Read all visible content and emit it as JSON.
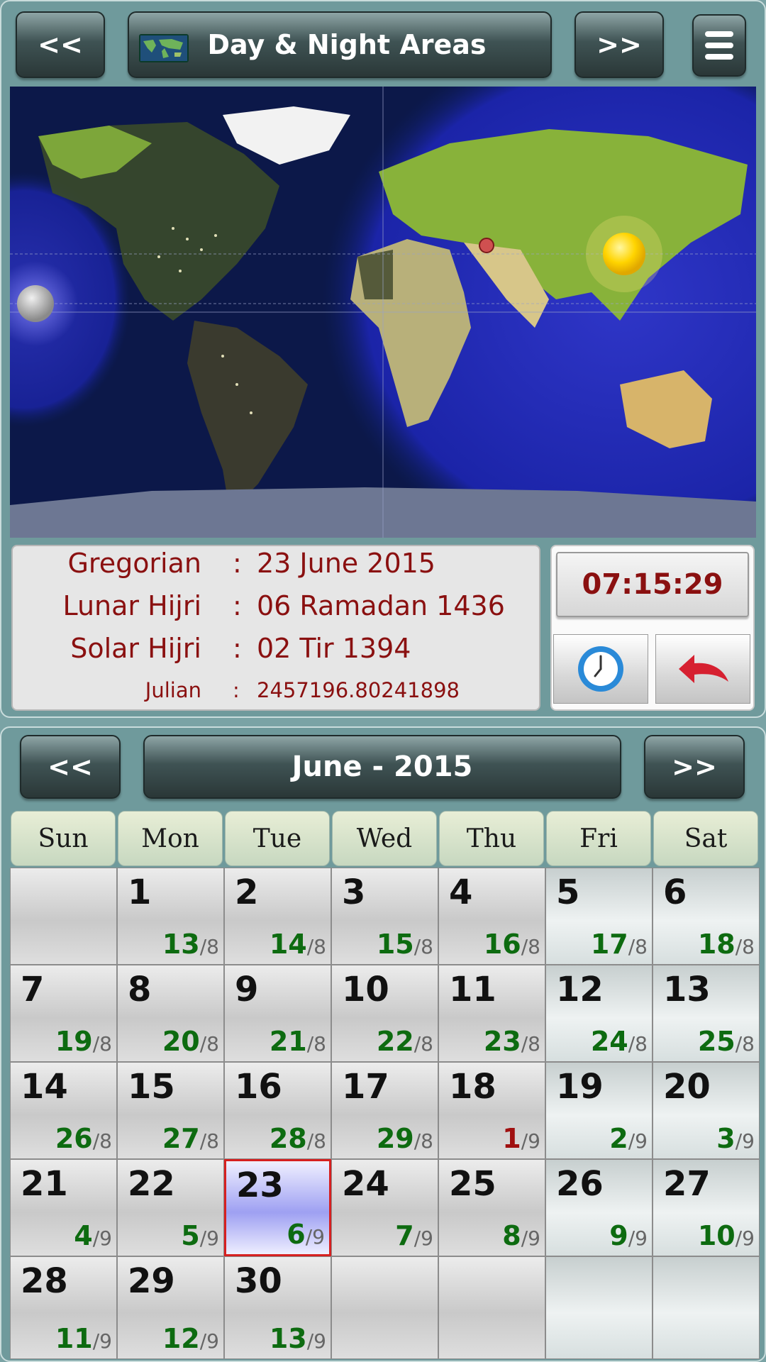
{
  "header": {
    "prev_label": "<<",
    "title": "Day & Night Areas",
    "next_label": ">>"
  },
  "info": {
    "gregorian_label": "Gregorian",
    "gregorian_value": "23 June 2015",
    "lunar_label": "Lunar Hijri",
    "lunar_value": "06 Ramadan 1436",
    "solar_label": "Solar Hijri",
    "solar_value": "02 Tir 1394",
    "julian_label": "Julian",
    "julian_value": "2457196.80241898",
    "separator": ":"
  },
  "clock": {
    "time": "07:15:29"
  },
  "calendar": {
    "prev_label": "<<",
    "month_title": "June - 2015",
    "next_label": ">>",
    "weekdays": [
      "Sun",
      "Mon",
      "Tue",
      "Wed",
      "Thu",
      "Fri",
      "Sat"
    ],
    "today": "23",
    "weeks": [
      [
        null,
        [
          "1",
          "13",
          "8"
        ],
        [
          "2",
          "14",
          "8"
        ],
        [
          "3",
          "15",
          "8"
        ],
        [
          "4",
          "16",
          "8"
        ],
        [
          "5",
          "17",
          "8"
        ],
        [
          "6",
          "18",
          "8"
        ]
      ],
      [
        [
          "7",
          "19",
          "8"
        ],
        [
          "8",
          "20",
          "8"
        ],
        [
          "9",
          "21",
          "8"
        ],
        [
          "10",
          "22",
          "8"
        ],
        [
          "11",
          "23",
          "8"
        ],
        [
          "12",
          "24",
          "8"
        ],
        [
          "13",
          "25",
          "8"
        ]
      ],
      [
        [
          "14",
          "26",
          "8"
        ],
        [
          "15",
          "27",
          "8"
        ],
        [
          "16",
          "28",
          "8"
        ],
        [
          "17",
          "29",
          "8"
        ],
        [
          "18",
          "1",
          "9"
        ],
        [
          "19",
          "2",
          "9"
        ],
        [
          "20",
          "3",
          "9"
        ]
      ],
      [
        [
          "21",
          "4",
          "9"
        ],
        [
          "22",
          "5",
          "9"
        ],
        [
          "23",
          "6",
          "9"
        ],
        [
          "24",
          "7",
          "9"
        ],
        [
          "25",
          "8",
          "9"
        ],
        [
          "26",
          "9",
          "9"
        ],
        [
          "27",
          "10",
          "9"
        ]
      ],
      [
        [
          "28",
          "11",
          "9"
        ],
        [
          "29",
          "12",
          "9"
        ],
        [
          "30",
          "13",
          "9"
        ],
        null,
        null,
        null,
        null
      ]
    ],
    "highlight_red_day": "18"
  },
  "colors": {
    "accent_red": "#8a1010",
    "hijri_green": "#0d6b10",
    "today_border": "#d62020"
  }
}
